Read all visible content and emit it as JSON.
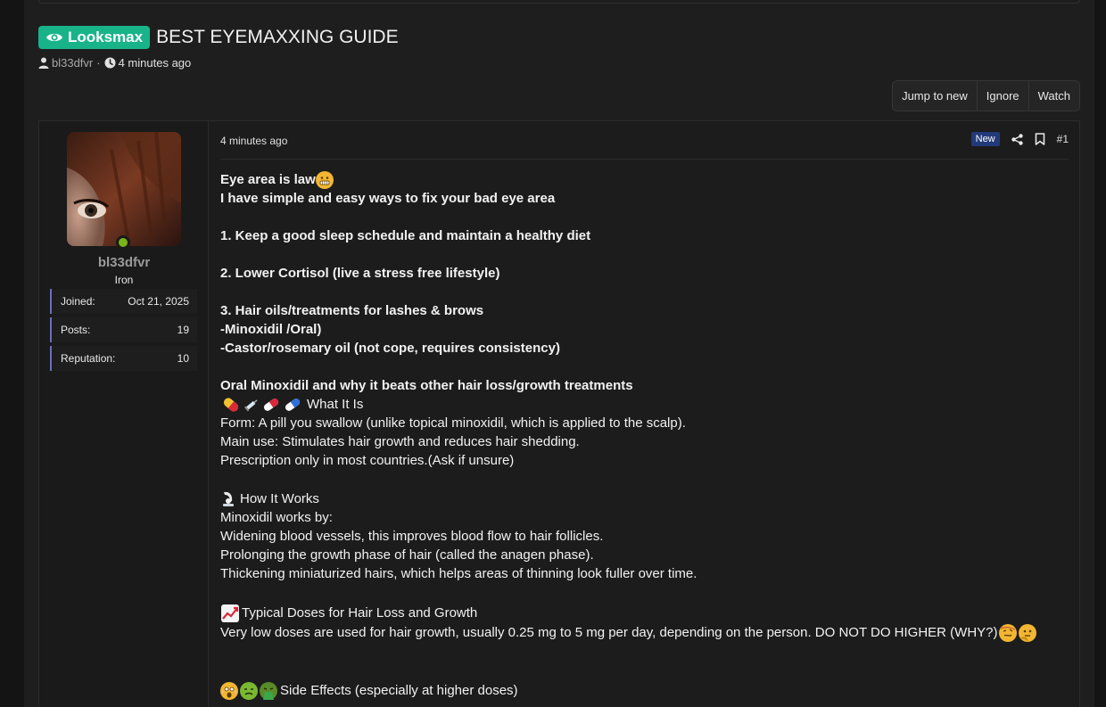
{
  "thread": {
    "prefix": "Looksmax",
    "title": "BEST EYEMAXXING GUIDE",
    "author": "bl33dfvr",
    "separator": "·",
    "time": "4 minutes ago"
  },
  "actions": {
    "jump_to_new": "Jump to new",
    "ignore": "Ignore",
    "watch": "Watch"
  },
  "user": {
    "name": "bl33dfvr",
    "title": "Iron",
    "stats": [
      {
        "label": "Joined:",
        "value": "Oct 21, 2025"
      },
      {
        "label": "Posts:",
        "value": "19"
      },
      {
        "label": "Reputation:",
        "value": "10"
      }
    ]
  },
  "post": {
    "date": "4 minutes ago",
    "badge": "New",
    "number": "#1",
    "lines": {
      "l1": "Eye area is law",
      "l2": "I have simple and easy ways to fix your bad eye area",
      "l3": "1. Keep a good sleep schedule and maintain a healthy diet",
      "l4": "2. Lower Cortisol (live a stress free lifestyle)",
      "l5": "3. Hair oils/treatments for lashes & brows",
      "l6": "-Minoxidil /Oral)",
      "l7": "-Castor/rosemary oil (not cope, requires consistency)",
      "l8": "Oral Minoxidil and why it beats other hair loss/growth treatments",
      "l9": "What It Is",
      "l10": "Form: A pill you swallow (unlike topical minoxidil, which is applied to the scalp).",
      "l11": "Main use: Stimulates hair growth and reduces hair shedding.",
      "l12": "Prescription only in most countries.(Ask if unsure)",
      "l13": "How It Works",
      "l14": "Minoxidil works by:",
      "l15": "Widening blood vessels, this improves blood flow to hair follicles.",
      "l16": "Prolonging the growth phase of hair (called the anagen phase).",
      "l17": "Thickening miniaturized hairs, which helps areas of thinning look fuller over time.",
      "l18": "Typical Doses for Hair Loss and Growth",
      "l19": "Very low doses are used for hair growth, usually 0.25 mg to 5 mg per day, depending on the person. DO NOT DO HIGHER (WHY?)",
      "l20": "Side Effects (especially at higher doses)"
    }
  },
  "colors": {
    "prefix_bg": "#19b38a",
    "online": "#7ab317",
    "badge_new": "#233a7a",
    "stat_border": "#6c6fc0"
  }
}
